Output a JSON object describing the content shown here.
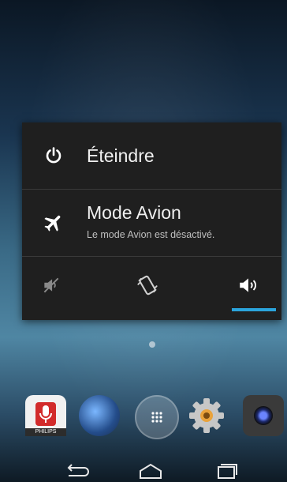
{
  "power_menu": {
    "power_off_label": "Éteindre",
    "airplane": {
      "title": "Mode Avion",
      "status": "Le mode Avion est désactivé."
    },
    "sound_modes": [
      {
        "name": "silent"
      },
      {
        "name": "vibrate"
      },
      {
        "name": "sound",
        "selected": true
      }
    ]
  },
  "colors": {
    "accent": "#2ba4dc",
    "dialog_bg": "#1f1f1f"
  },
  "home": {
    "dock_apps": [
      "voice-search-app",
      "globe-app",
      "app-drawer",
      "settings-app",
      "camera-app"
    ],
    "voice_app_caption": "PHILIPS"
  },
  "nav": {
    "buttons": [
      "back",
      "home",
      "recent-apps"
    ]
  }
}
